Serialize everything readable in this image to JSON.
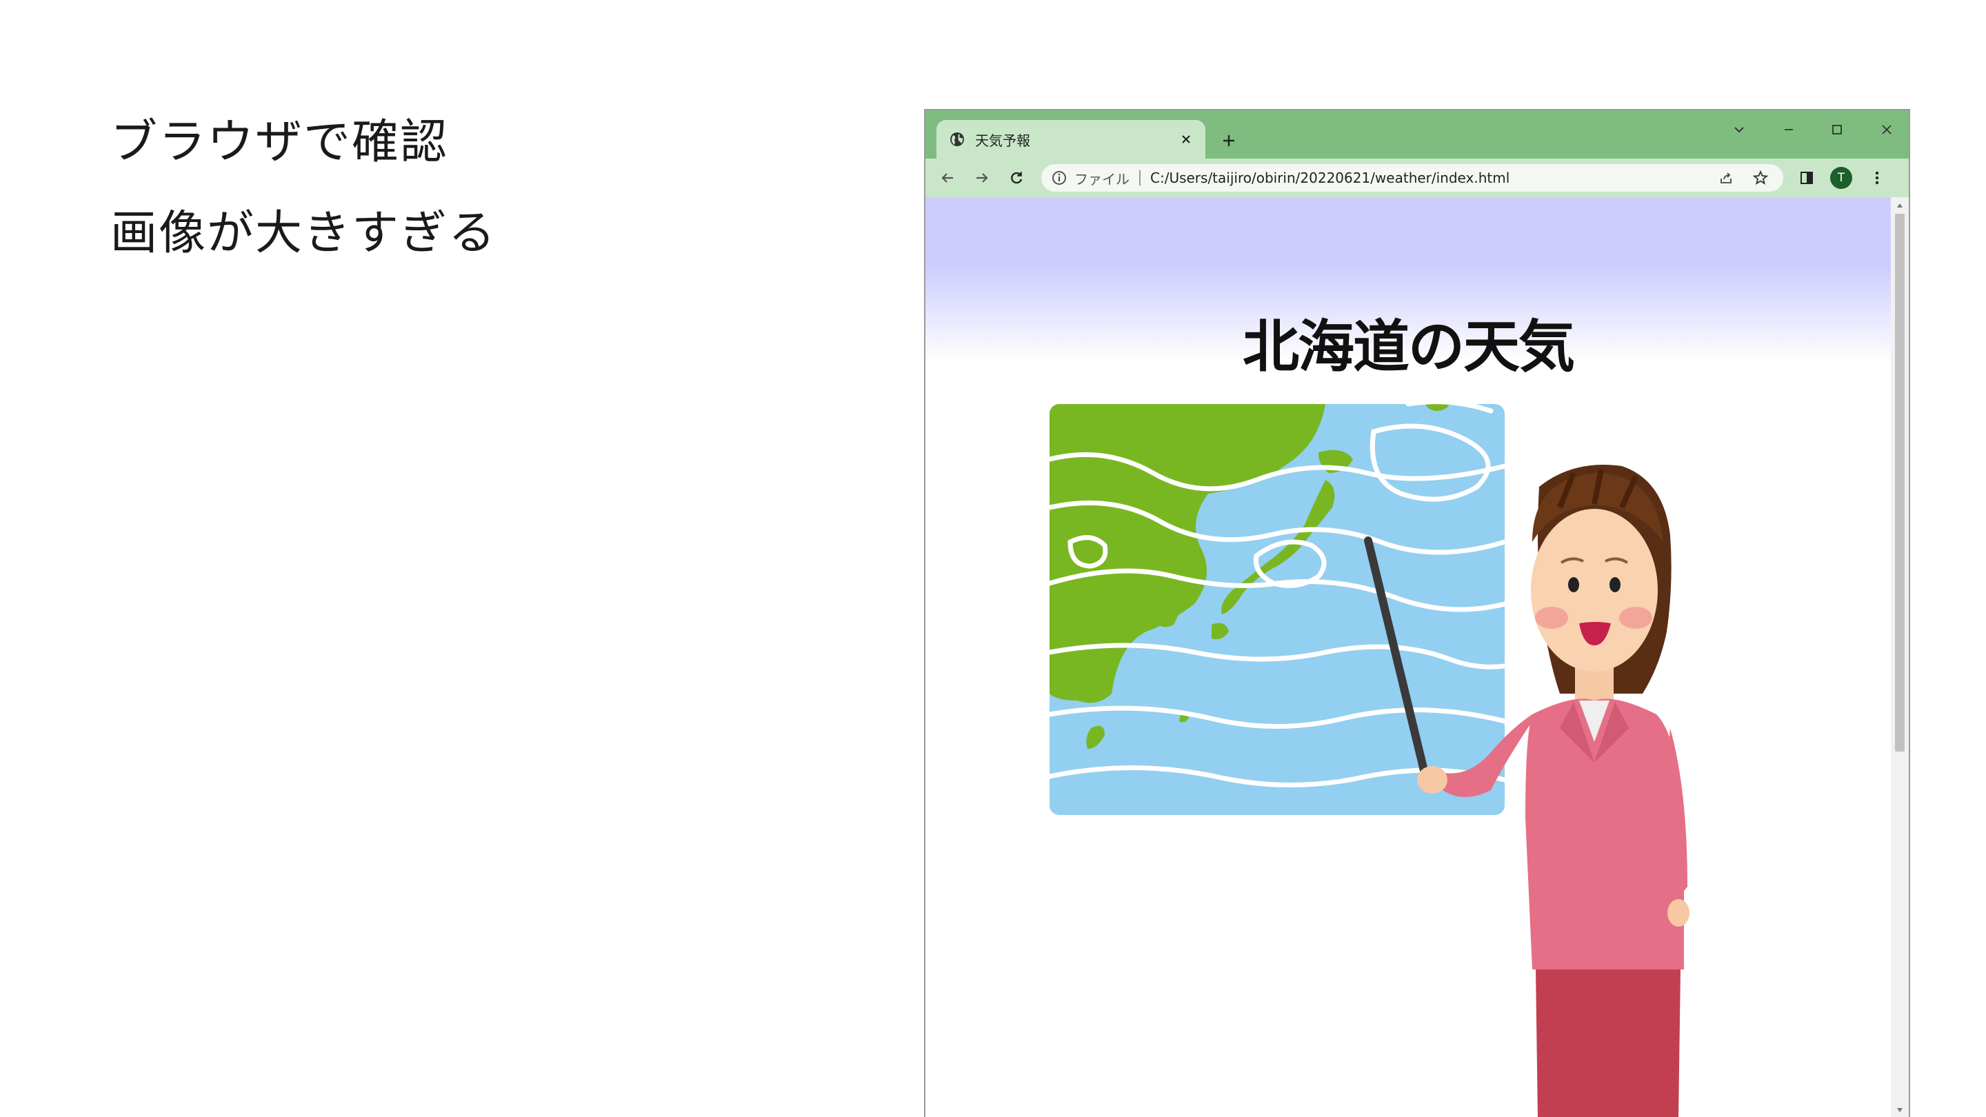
{
  "slide": {
    "notes": [
      "ブラウザで確認",
      "画像が大きすぎる"
    ]
  },
  "browser": {
    "tab": {
      "title": "天気予報",
      "favicon": "globe-icon"
    },
    "toolbar": {
      "file_label": "ファイル",
      "url": "C:/Users/taijiro/obirin/20220621/weather/index.html",
      "profile_initial": "T"
    },
    "colors": {
      "titlebar": "#7ebd7f",
      "toolbar": "#c9e6c9",
      "header_gradient_top": "#cdcdfd"
    }
  },
  "page": {
    "heading": "北海道の天気",
    "image": "weather-presenter-illustration"
  }
}
